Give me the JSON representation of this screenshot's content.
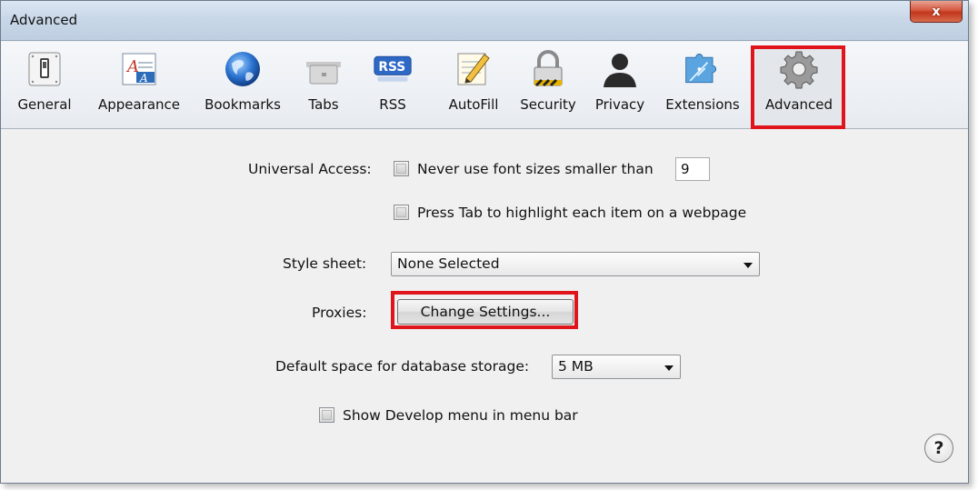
{
  "window": {
    "title": "Advanced",
    "close_label": "x"
  },
  "toolbar": {
    "items": [
      {
        "label": "General",
        "icon": "general-switch-icon"
      },
      {
        "label": "Appearance",
        "icon": "appearance-font-icon"
      },
      {
        "label": "Bookmarks",
        "icon": "globe-icon"
      },
      {
        "label": "Tabs",
        "icon": "tabs-icon"
      },
      {
        "label": "RSS",
        "icon": "rss-icon",
        "badge": "RSS"
      },
      {
        "label": "AutoFill",
        "icon": "pencil-notepad-icon"
      },
      {
        "label": "Security",
        "icon": "padlock-icon"
      },
      {
        "label": "Privacy",
        "icon": "person-silhouette-icon"
      },
      {
        "label": "Extensions",
        "icon": "puzzle-compass-icon"
      },
      {
        "label": "Advanced",
        "icon": "gear-icon",
        "selected": true
      }
    ]
  },
  "settings": {
    "universal_access_label": "Universal Access:",
    "font_size_option": "Never use font sizes smaller than",
    "font_size_value": "9",
    "press_tab_option": "Press Tab to highlight each item on a webpage",
    "style_sheet_label": "Style sheet:",
    "style_sheet_value": "None Selected",
    "proxies_label": "Proxies:",
    "proxies_button": "Change Settings...",
    "db_storage_label": "Default space for database storage:",
    "db_storage_value": "5 MB",
    "develop_menu_option": "Show Develop menu in menu bar",
    "help_label": "?"
  },
  "colors": {
    "highlight": "#e0141b",
    "close_button": "#c2361c"
  }
}
